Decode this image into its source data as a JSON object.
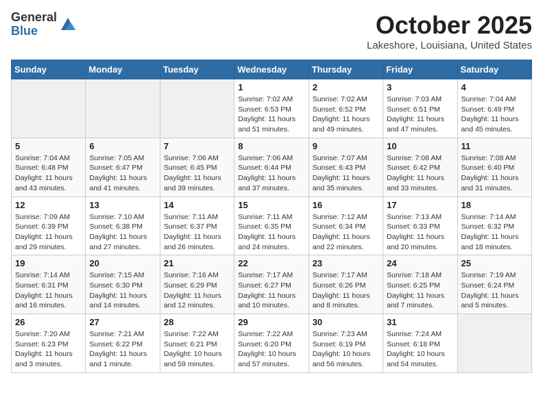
{
  "header": {
    "logo_general": "General",
    "logo_blue": "Blue",
    "month_title": "October 2025",
    "location": "Lakeshore, Louisiana, United States"
  },
  "weekdays": [
    "Sunday",
    "Monday",
    "Tuesday",
    "Wednesday",
    "Thursday",
    "Friday",
    "Saturday"
  ],
  "weeks": [
    [
      {
        "day": "",
        "info": ""
      },
      {
        "day": "",
        "info": ""
      },
      {
        "day": "",
        "info": ""
      },
      {
        "day": "1",
        "info": "Sunrise: 7:02 AM\nSunset: 6:53 PM\nDaylight: 11 hours\nand 51 minutes."
      },
      {
        "day": "2",
        "info": "Sunrise: 7:02 AM\nSunset: 6:52 PM\nDaylight: 11 hours\nand 49 minutes."
      },
      {
        "day": "3",
        "info": "Sunrise: 7:03 AM\nSunset: 6:51 PM\nDaylight: 11 hours\nand 47 minutes."
      },
      {
        "day": "4",
        "info": "Sunrise: 7:04 AM\nSunset: 6:49 PM\nDaylight: 11 hours\nand 45 minutes."
      }
    ],
    [
      {
        "day": "5",
        "info": "Sunrise: 7:04 AM\nSunset: 6:48 PM\nDaylight: 11 hours\nand 43 minutes."
      },
      {
        "day": "6",
        "info": "Sunrise: 7:05 AM\nSunset: 6:47 PM\nDaylight: 11 hours\nand 41 minutes."
      },
      {
        "day": "7",
        "info": "Sunrise: 7:06 AM\nSunset: 6:45 PM\nDaylight: 11 hours\nand 39 minutes."
      },
      {
        "day": "8",
        "info": "Sunrise: 7:06 AM\nSunset: 6:44 PM\nDaylight: 11 hours\nand 37 minutes."
      },
      {
        "day": "9",
        "info": "Sunrise: 7:07 AM\nSunset: 6:43 PM\nDaylight: 11 hours\nand 35 minutes."
      },
      {
        "day": "10",
        "info": "Sunrise: 7:08 AM\nSunset: 6:42 PM\nDaylight: 11 hours\nand 33 minutes."
      },
      {
        "day": "11",
        "info": "Sunrise: 7:08 AM\nSunset: 6:40 PM\nDaylight: 11 hours\nand 31 minutes."
      }
    ],
    [
      {
        "day": "12",
        "info": "Sunrise: 7:09 AM\nSunset: 6:39 PM\nDaylight: 11 hours\nand 29 minutes."
      },
      {
        "day": "13",
        "info": "Sunrise: 7:10 AM\nSunset: 6:38 PM\nDaylight: 11 hours\nand 27 minutes."
      },
      {
        "day": "14",
        "info": "Sunrise: 7:11 AM\nSunset: 6:37 PM\nDaylight: 11 hours\nand 26 minutes."
      },
      {
        "day": "15",
        "info": "Sunrise: 7:11 AM\nSunset: 6:35 PM\nDaylight: 11 hours\nand 24 minutes."
      },
      {
        "day": "16",
        "info": "Sunrise: 7:12 AM\nSunset: 6:34 PM\nDaylight: 11 hours\nand 22 minutes."
      },
      {
        "day": "17",
        "info": "Sunrise: 7:13 AM\nSunset: 6:33 PM\nDaylight: 11 hours\nand 20 minutes."
      },
      {
        "day": "18",
        "info": "Sunrise: 7:14 AM\nSunset: 6:32 PM\nDaylight: 11 hours\nand 18 minutes."
      }
    ],
    [
      {
        "day": "19",
        "info": "Sunrise: 7:14 AM\nSunset: 6:31 PM\nDaylight: 11 hours\nand 16 minutes."
      },
      {
        "day": "20",
        "info": "Sunrise: 7:15 AM\nSunset: 6:30 PM\nDaylight: 11 hours\nand 14 minutes."
      },
      {
        "day": "21",
        "info": "Sunrise: 7:16 AM\nSunset: 6:29 PM\nDaylight: 11 hours\nand 12 minutes."
      },
      {
        "day": "22",
        "info": "Sunrise: 7:17 AM\nSunset: 6:27 PM\nDaylight: 11 hours\nand 10 minutes."
      },
      {
        "day": "23",
        "info": "Sunrise: 7:17 AM\nSunset: 6:26 PM\nDaylight: 11 hours\nand 8 minutes."
      },
      {
        "day": "24",
        "info": "Sunrise: 7:18 AM\nSunset: 6:25 PM\nDaylight: 11 hours\nand 7 minutes."
      },
      {
        "day": "25",
        "info": "Sunrise: 7:19 AM\nSunset: 6:24 PM\nDaylight: 11 hours\nand 5 minutes."
      }
    ],
    [
      {
        "day": "26",
        "info": "Sunrise: 7:20 AM\nSunset: 6:23 PM\nDaylight: 11 hours\nand 3 minutes."
      },
      {
        "day": "27",
        "info": "Sunrise: 7:21 AM\nSunset: 6:22 PM\nDaylight: 11 hours\nand 1 minute."
      },
      {
        "day": "28",
        "info": "Sunrise: 7:22 AM\nSunset: 6:21 PM\nDaylight: 10 hours\nand 59 minutes."
      },
      {
        "day": "29",
        "info": "Sunrise: 7:22 AM\nSunset: 6:20 PM\nDaylight: 10 hours\nand 57 minutes."
      },
      {
        "day": "30",
        "info": "Sunrise: 7:23 AM\nSunset: 6:19 PM\nDaylight: 10 hours\nand 56 minutes."
      },
      {
        "day": "31",
        "info": "Sunrise: 7:24 AM\nSunset: 6:18 PM\nDaylight: 10 hours\nand 54 minutes."
      },
      {
        "day": "",
        "info": ""
      }
    ]
  ]
}
